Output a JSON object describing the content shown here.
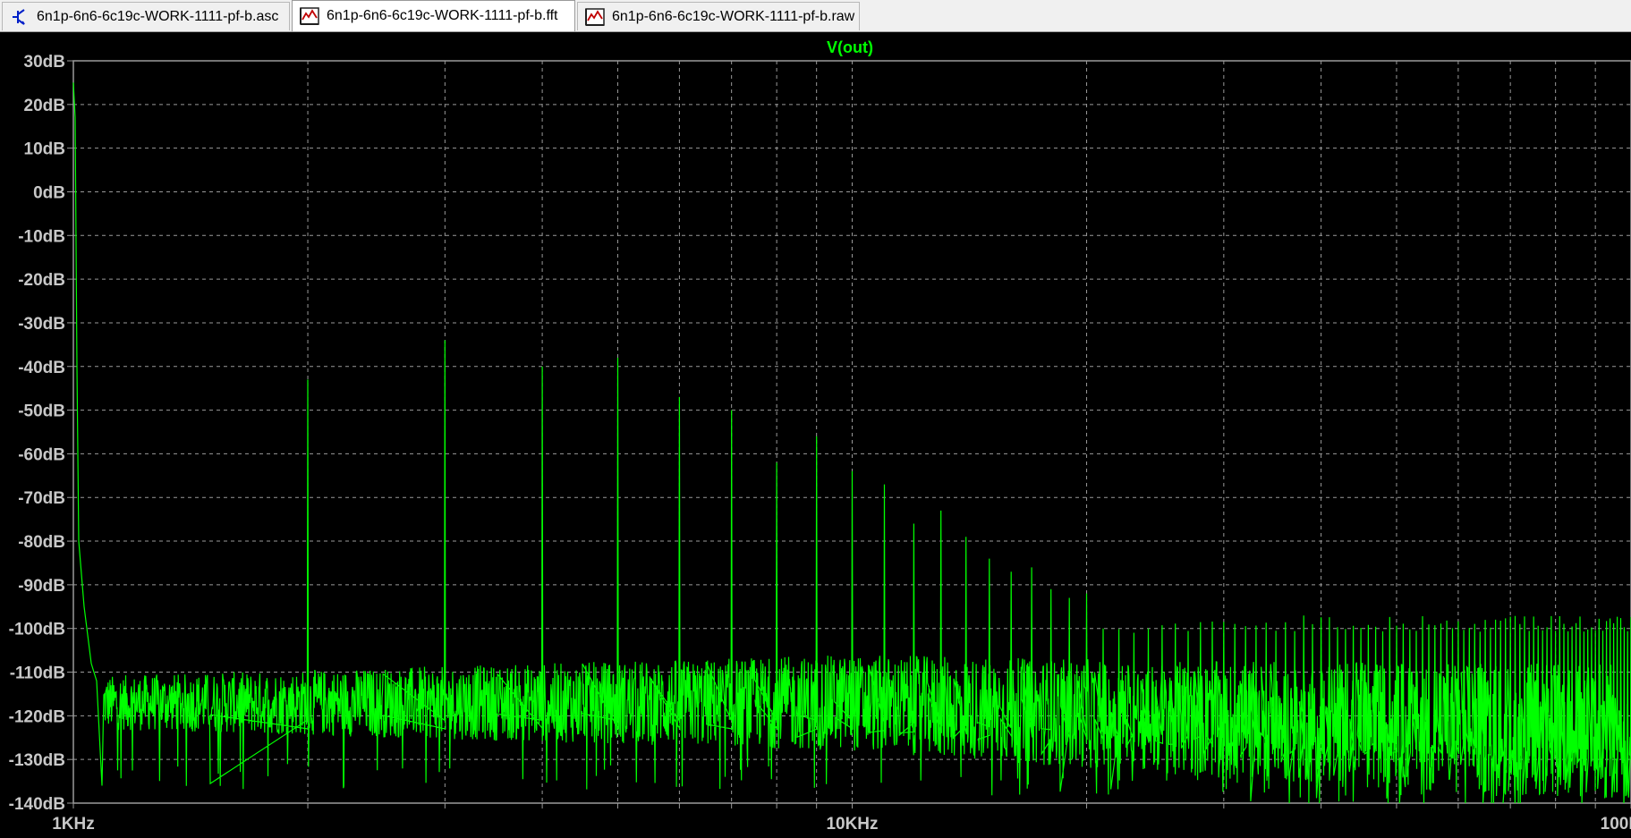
{
  "tabs": [
    {
      "label": "6n1p-6n6-6c19c-WORK-1111-pf-b.asc",
      "icon": "schematic-icon",
      "active": false
    },
    {
      "label": "6n1p-6n6-6c19c-WORK-1111-pf-b.fft",
      "icon": "waveform-icon",
      "active": true
    },
    {
      "label": "6n1p-6n6-6c19c-WORK-1111-pf-b.raw",
      "icon": "waveform-icon",
      "active": false
    }
  ],
  "colors": {
    "trace": "#00ff00",
    "background": "#000000",
    "grid": "#9a9a9a",
    "axis_text": "#c8c8c8"
  },
  "chart_data": {
    "type": "line",
    "title": "V(out)",
    "xscale": "log",
    "xlim": [
      1000,
      100000
    ],
    "ylim": [
      -140,
      30
    ],
    "xtick_labels": [
      "1KHz",
      "10KHz",
      "100KHz"
    ],
    "ytick_labels": [
      "30dB",
      "20dB",
      "10dB",
      "0dB",
      "-10dB",
      "-20dB",
      "-30dB",
      "-40dB",
      "-50dB",
      "-60dB",
      "-70dB",
      "-80dB",
      "-90dB",
      "-100dB",
      "-110dB",
      "-120dB",
      "-130dB",
      "-140dB"
    ],
    "grid": true,
    "series": [
      {
        "name": "V(out)",
        "fundamental": {
          "x": 1000,
          "y": 25
        },
        "harmonics": [
          {
            "x": 2000,
            "y": -43
          },
          {
            "x": 3000,
            "y": -34
          },
          {
            "x": 4000,
            "y": -40
          },
          {
            "x": 5000,
            "y": -38
          },
          {
            "x": 6000,
            "y": -47
          },
          {
            "x": 7000,
            "y": -50
          },
          {
            "x": 8000,
            "y": -62
          },
          {
            "x": 9000,
            "y": -56
          },
          {
            "x": 10000,
            "y": -64
          },
          {
            "x": 11000,
            "y": -67
          },
          {
            "x": 12000,
            "y": -76
          },
          {
            "x": 13000,
            "y": -73
          },
          {
            "x": 14000,
            "y": -79
          },
          {
            "x": 15000,
            "y": -84
          },
          {
            "x": 16000,
            "y": -87
          },
          {
            "x": 17000,
            "y": -86
          },
          {
            "x": 18000,
            "y": -91
          },
          {
            "x": 19000,
            "y": -93
          },
          {
            "x": 20000,
            "y": -92
          }
        ],
        "high_harmonics_level": -99,
        "noise_floor": [
          {
            "x": 1000,
            "y": -117
          },
          {
            "x": 10000,
            "y": -117
          },
          {
            "x": 30000,
            "y": -121
          },
          {
            "x": 100000,
            "y": -124
          }
        ]
      }
    ]
  }
}
